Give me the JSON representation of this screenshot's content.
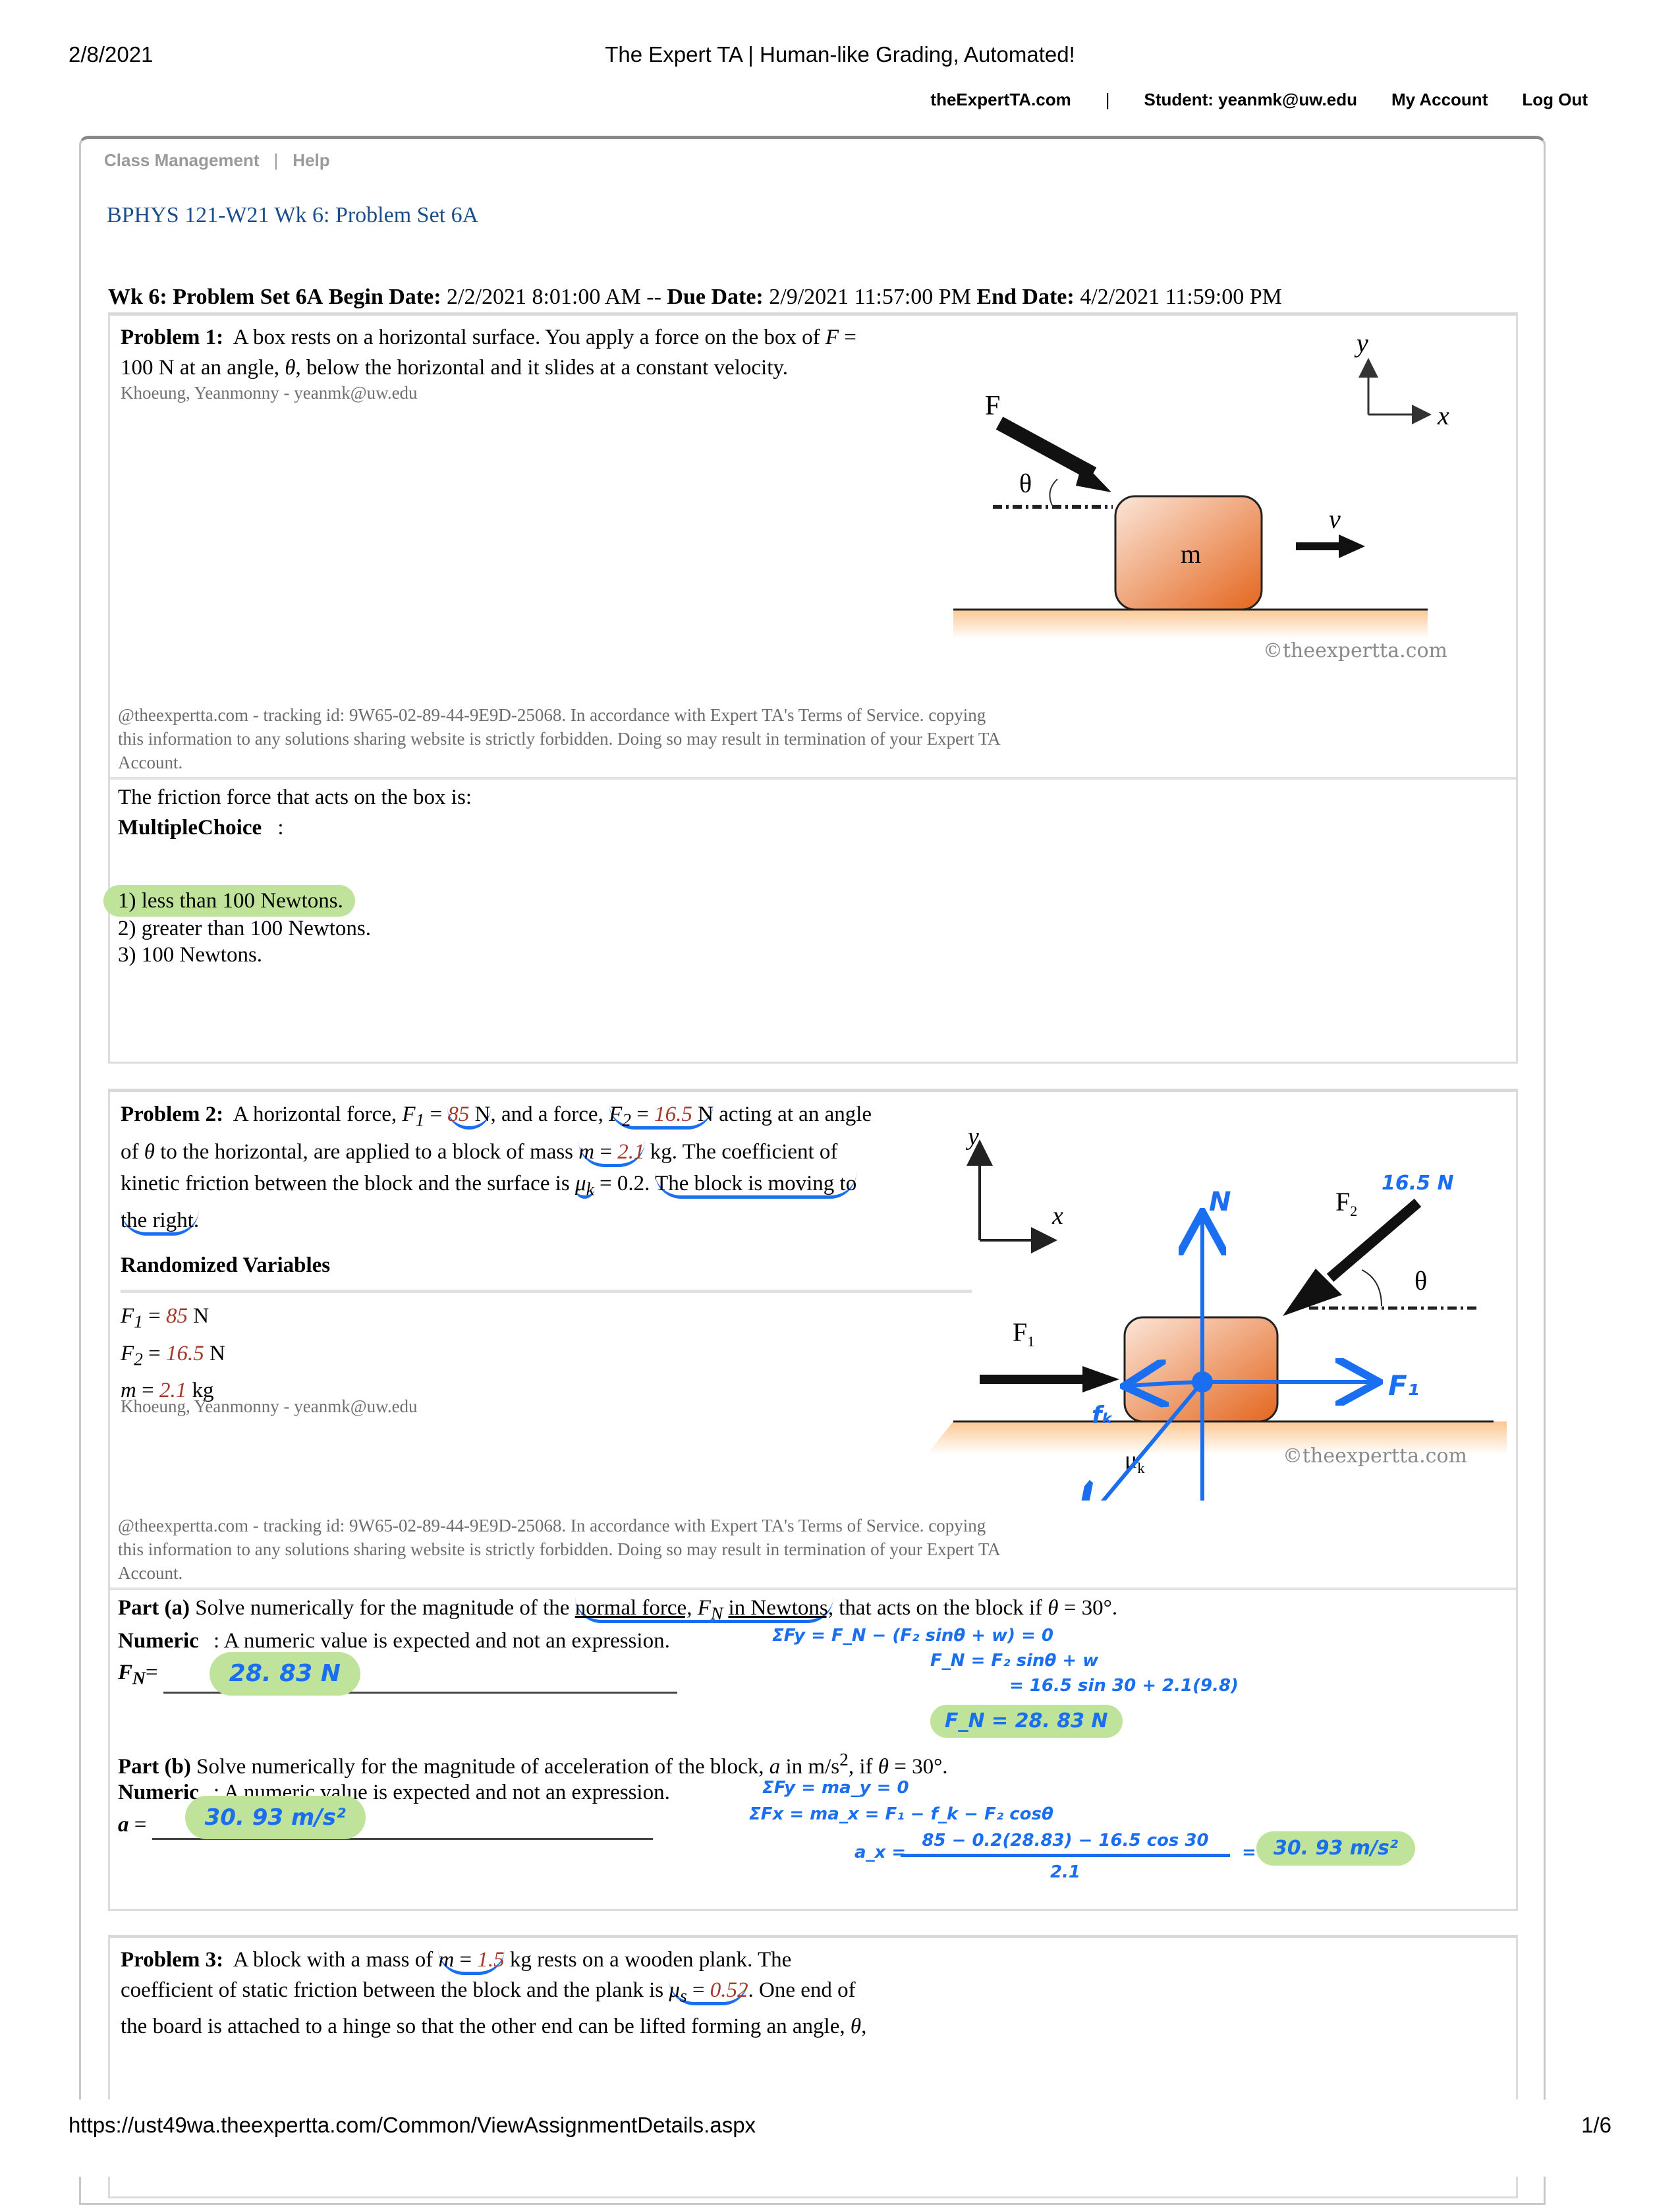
{
  "print": {
    "date": "2/8/2021",
    "title": "The Expert TA | Human-like Grading, Automated!",
    "url": "https://ust49wa.theexpertta.com/Common/ViewAssignmentDetails.aspx",
    "page": "1/6"
  },
  "topnav": {
    "site": "theExpertTA.com",
    "separator": "|",
    "student": "Student: yeanmk@uw.edu",
    "my_account": "My Account",
    "log_out": "Log Out"
  },
  "subnav": {
    "class_management": "Class Management",
    "separator": "|",
    "help": "Help"
  },
  "course_title": "BPHYS 121-W21 Wk 6: Problem Set 6A",
  "dates": {
    "assignment": "Wk 6: Problem Set 6A",
    "begin_label": "Begin Date:",
    "begin": "2/2/2021 8:01:00 AM",
    "dash": "--",
    "due_label": "Due Date:",
    "due": "2/9/2021 11:57:00 PM",
    "end_label": "End Date:",
    "end": "4/2/2021 11:59:00 PM"
  },
  "colors": {
    "variable": "#a5392a",
    "title_blue": "#1c4e8c",
    "annotation_blue": "#1a6ff0",
    "highlight_green": "#bfe39a"
  },
  "legal_text": "@theexpertta.com - tracking id: 9W65-02-89-44-9E9D-25068. In accordance with Expert TA's Terms of Service. copying this information to any solutions sharing website is strictly forbidden. Doing so may result in termination of your Expert TA Account.",
  "author": "Khoeung, Yeanmonny - yeanmk@uw.edu",
  "problem1": {
    "label": "Problem 1:",
    "text_a": "A box rests on a horizontal surface. You apply a force on the box of",
    "F": "F",
    "eq": "=",
    "text_b": "100 N at an angle,",
    "theta": "θ",
    "text_c": ", below the horizontal and it slides at a constant velocity.",
    "figure": {
      "F_label": "F",
      "theta_label": "θ",
      "mass_label": "m",
      "v_label": "v",
      "x_label": "x",
      "y_label": "y",
      "copyright": "©theexpertta.com"
    },
    "question": "The friction force that acts on the box is:",
    "type_label": "MultipleChoice",
    "type_colon": ":",
    "options": [
      "1) less than 100 Newtons.",
      "2) greater than 100 Newtons.",
      "3) 100 Newtons."
    ],
    "selected_option": 0
  },
  "problem2": {
    "label": "Problem 2:",
    "line1_a": "A horizontal force,",
    "F1": "F",
    "F1_sub": "1",
    "eq": "=",
    "F1_val": "85",
    "unit_N": "N",
    "line1_b": ", and a force,",
    "F2": "F",
    "F2_sub": "2",
    "F2_val": "16.5",
    "line1_c": "acting at an angle",
    "line2_a": "of",
    "theta": "θ",
    "line2_b": "to the horizontal, are applied to a block of mass",
    "m": "m",
    "m_val": "2.1",
    "line2_c": "kg. The coefficient of",
    "line3_a": "kinetic friction between the block and the surface is",
    "mu": "μ",
    "mu_sub": "k",
    "mu_val": "= 0.2.",
    "line3_b": "The block is moving to",
    "line4": "the right.",
    "randomized_heading": "Randomized Variables",
    "randomized": [
      {
        "sym": "F",
        "sub": "1",
        "val": "85",
        "unit": "N"
      },
      {
        "sym": "F",
        "sub": "2",
        "val": "16.5",
        "unit": "N"
      },
      {
        "sym": "m",
        "sub": "",
        "val": "2.1",
        "unit": "kg"
      }
    ],
    "figure": {
      "x_label": "x",
      "y_label": "y",
      "F1_label": "F",
      "F1_sub": "1",
      "F2_label": "F",
      "F2_sub": "2",
      "theta_label": "θ",
      "mu_label": "μ",
      "mu_sub": "k",
      "copyright": "©theexpertta.com",
      "annotations": {
        "N": "N",
        "F2_value": "16.5 N",
        "F1": "F₁",
        "fk": "fₖ",
        "F2": "F₂",
        "W": "w"
      }
    },
    "part_a": {
      "label": "Part (a)",
      "text_a": "Solve numerically for the magnitude of the",
      "text_u": "normal force,",
      "FN": "F",
      "FN_sub": "N",
      "text_u2": "in Newtons,",
      "text_b": "that acts on the block if",
      "theta": "θ",
      "text_c": "= 30°.",
      "type_label": "Numeric",
      "type_desc": ": A numeric value is expected and not an expression.",
      "input_sym": "F",
      "input_sub": "N",
      "input_eq": "=",
      "answer": "28. 83 N",
      "work": [
        "ΣFy = F_N − (F₂ sinθ + w) = 0",
        "F_N =  F₂ sinθ + w",
        "= 16.5 sin 30 + 2.1(9.8)",
        "F_N = 28. 83 N"
      ]
    },
    "part_b": {
      "label": "Part (b)",
      "text_a": "Solve numerically for the magnitude of acceleration of the block,",
      "a": "a",
      "text_b": "in m/s",
      "sup": "2",
      "text_c": ", if",
      "theta": "θ",
      "text_d": "= 30°.",
      "type_label": "Numeric",
      "type_desc": ": A numeric value is expected and not an expression.",
      "input_sym": "a",
      "input_eq": "=",
      "answer": "30. 93 m/s²",
      "work": [
        "ΣFy = ma_y = 0",
        "ΣFx = ma_x = F₁ − f_k − F₂ cosθ",
        "a_x =",
        "85 − 0.2(28.83) − 16.5 cos 30",
        "2.1",
        "= ",
        "30. 93 m/s²"
      ]
    }
  },
  "problem3": {
    "label": "Problem 3:",
    "line1_a": "A block with a mass of",
    "m": "m",
    "eq": "=",
    "m_val": "1.5",
    "line1_b": "kg rests on a wooden plank. The",
    "line2_a": "coefficient of static friction between the block and the plank is",
    "mu": "μ",
    "mu_sub": "s",
    "mu_val": "0.52",
    "line2_b": ". One end of",
    "line3": "the board is attached to a hinge so that the other end can be lifted forming an angle,",
    "theta": "θ",
    "line3_end": ","
  }
}
